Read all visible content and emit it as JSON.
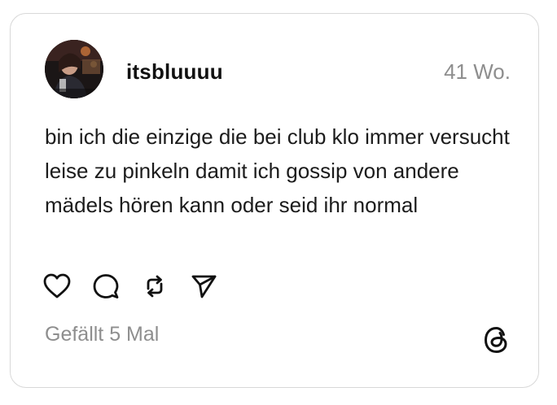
{
  "post": {
    "username": "itsbluuuu",
    "timestamp": "41 Wo.",
    "text": "bin ich die einzige die bei club klo immer versucht leise zu pinkeln damit ich gossip von andere mädels hören kann oder seid ihr normal",
    "likes_label": "Gefällt 5 Mal"
  },
  "actions": [
    {
      "icon": "heart-icon",
      "name": "like-button"
    },
    {
      "icon": "comment-icon",
      "name": "comment-button"
    },
    {
      "icon": "repost-icon",
      "name": "repost-button"
    },
    {
      "icon": "send-icon",
      "name": "share-button"
    }
  ],
  "brand": {
    "icon": "threads-logo-icon"
  },
  "colors": {
    "text": "#1c1c1c",
    "muted": "#8e8e8e",
    "border": "#d8d8d8",
    "background": "#ffffff"
  }
}
